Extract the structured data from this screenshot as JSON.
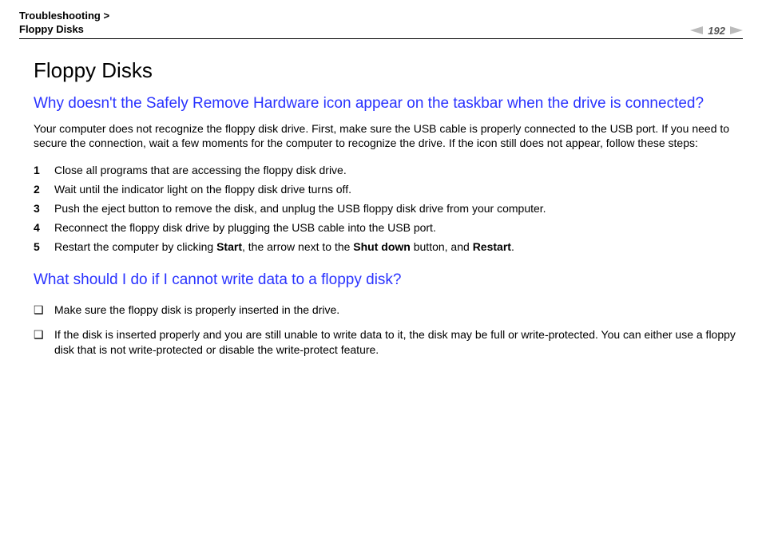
{
  "header": {
    "breadcrumb1": "Troubleshooting",
    "breadcrumb_sep": " > ",
    "breadcrumb2": "Floppy Disks",
    "page_number": "192"
  },
  "main": {
    "title": "Floppy Disks",
    "q1": {
      "heading": "Why doesn't the Safely Remove Hardware icon appear on the taskbar when the drive is connected?",
      "intro": "Your computer does not recognize the floppy disk drive. First, make sure the USB cable is properly connected to the USB port. If you need to secure the connection, wait a few moments for the computer to recognize the drive. If the icon still does not appear, follow these steps:",
      "steps": [
        "Close all programs that are accessing the floppy disk drive.",
        "Wait until the indicator light on the floppy disk drive turns off.",
        "Push the eject button to remove the disk, and unplug the USB floppy disk drive from your computer.",
        "Reconnect the floppy disk drive by plugging the USB cable into the USB port."
      ],
      "step5_parts": {
        "p1": "Restart the computer by clicking ",
        "b1": "Start",
        "p2": ", the arrow next to the ",
        "b2": "Shut down",
        "p3": " button, and ",
        "b3": "Restart",
        "p4": "."
      }
    },
    "q2": {
      "heading": "What should I do if I cannot write data to a floppy disk?",
      "bullets": [
        "Make sure the floppy disk is properly inserted in the drive.",
        "If the disk is inserted properly and you are still unable to write data to it, the disk may be full or write-protected. You can either use a floppy disk that is not write-protected or disable the write-protect feature."
      ]
    }
  }
}
